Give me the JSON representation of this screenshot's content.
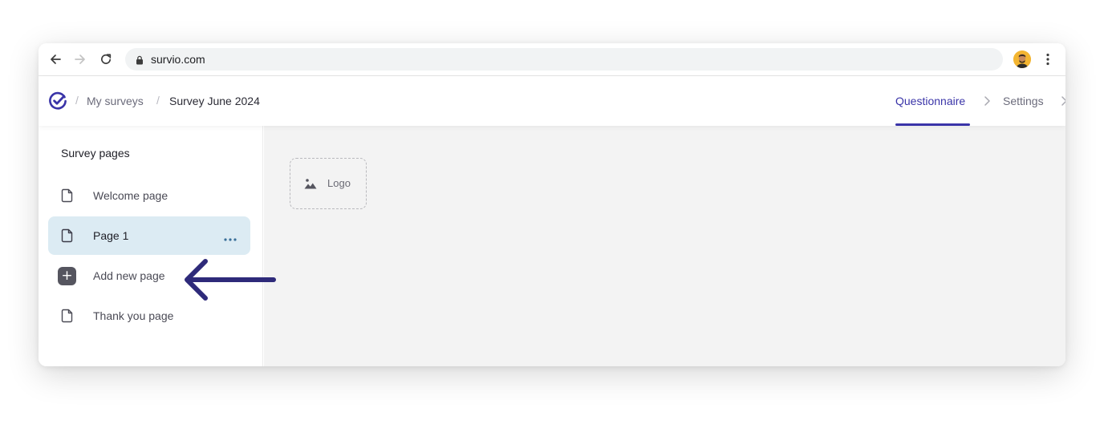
{
  "browser": {
    "url": "survio.com",
    "back_icon": "arrow-left-icon",
    "forward_icon": "arrow-right-icon",
    "reload_icon": "reload-icon",
    "lock_icon": "lock-icon",
    "menu_icon": "vertical-dots-icon"
  },
  "header": {
    "logo_icon": "survio-check-logo",
    "breadcrumb": {
      "separator": "/",
      "my_surveys": "My surveys",
      "current": "Survey June 2024"
    },
    "steps": [
      {
        "label": "Questionnaire",
        "active": true
      },
      {
        "label": "Settings",
        "active": false
      }
    ],
    "accent_color": "#3a34a8"
  },
  "sidebar": {
    "title": "Survey pages",
    "items": [
      {
        "label": "Welcome page",
        "icon": "page-icon",
        "selected": false
      },
      {
        "label": "Page 1",
        "icon": "page-icon",
        "selected": true,
        "menu_icon": "more-horizontal-icon"
      },
      {
        "label": "Add new page",
        "icon": "plus-icon",
        "selected": false
      },
      {
        "label": "Thank you page",
        "icon": "page-icon",
        "selected": false
      }
    ],
    "selected_color": "#dcebf3"
  },
  "canvas": {
    "logo_placeholder": {
      "label": "Logo",
      "icon": "image-icon"
    }
  },
  "annotation": {
    "type": "arrow",
    "points_to": "Add new page",
    "color": "#2e2a7a"
  }
}
